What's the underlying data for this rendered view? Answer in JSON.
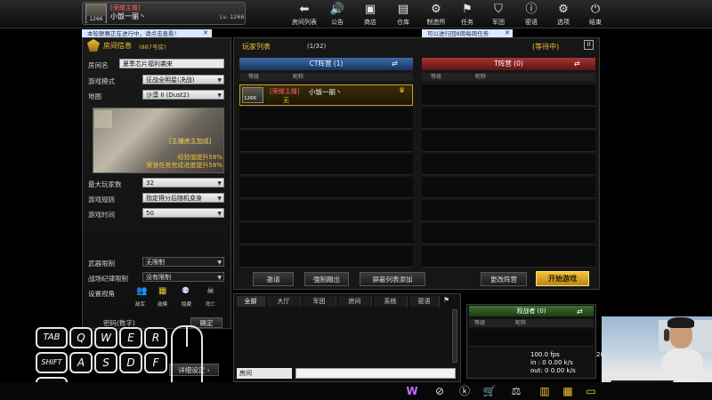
{
  "topbar": {
    "rank_title": "[荣耀主播]",
    "player_name": "小饭一丽丶",
    "level": "Lv. 1266",
    "rank_points": "1266",
    "nav": [
      {
        "label": "房间列表",
        "icon": "back-arrow-icon"
      },
      {
        "label": "公告",
        "icon": "speaker-icon"
      },
      {
        "label": "商店",
        "icon": "shop-icon"
      },
      {
        "label": "仓库",
        "icon": "inventory-icon"
      },
      {
        "label": "制造所",
        "icon": "craft-icon"
      },
      {
        "label": "任务",
        "icon": "mission-icon"
      },
      {
        "label": "军团",
        "icon": "clan-icon"
      },
      {
        "label": "密语",
        "icon": "alert-icon"
      },
      {
        "label": "选项",
        "icon": "gear-icon"
      },
      {
        "label": "结束",
        "icon": "power-icon"
      }
    ]
  },
  "notices": {
    "left": "本轮联赛正在进行中，请点击查看！",
    "right": "可以进行回8周每周任务"
  },
  "room": {
    "title": "房间信息",
    "room_no": "(887号房)",
    "name_label": "房间名",
    "name_value": "夏季芯片福利袭来",
    "mode_label": "游戏模式",
    "mode_value": "征战全明星(决战)",
    "map_label": "地图",
    "map_value": "沙漠 II (Dust2)",
    "map_banner": "[主播房主加成]",
    "map_bonus_1": "经验值提升58%",
    "map_bonus_2": "荣誉任务完成进度提升58%",
    "max_players_label": "最大玩家数",
    "max_players_value": "32",
    "rule_label": "游戏规则",
    "rule_value": "指定得分后随机变身",
    "time_label": "游戏时间",
    "time_value": "50",
    "weapon_label": "武器限制",
    "weapon_value": "无限制",
    "discipline_label": "战场纪律限制",
    "discipline_value": "没有限制",
    "view_label": "设置视角",
    "view_options": [
      "敌军",
      "敌模",
      "隐藏",
      "死亡"
    ],
    "password_label": "密码(数字)",
    "detail_button": "详细设定",
    "help_button": "帮助"
  },
  "players": {
    "title": "玩家列表",
    "count": "(1/32)",
    "status": "(等待中)",
    "ct_team": "CT阵营 (1)",
    "t_team": "T阵营 (0)",
    "col_rank": "等级",
    "col_name": "昵称",
    "slot_player_tag": "[荣耀主播]",
    "slot_player_name": "小饭一丽丶",
    "slot_player_suffix": "无",
    "slot_player_level": "1266",
    "buttons": {
      "invite": "邀请",
      "kick": "强制踢出",
      "block": "屏蔽列表添加",
      "change_team": "更改阵营",
      "start": "开始游戏"
    }
  },
  "chat": {
    "tabs": [
      "全部",
      "大厅",
      "军团",
      "房间",
      "系统",
      "密语"
    ],
    "input_label": "房间"
  },
  "spectator": {
    "title": "观战者 (0)",
    "col_rank": "等级",
    "col_name": "昵称"
  },
  "stats": {
    "fps": "100.0 fps",
    "in": "in : 0 0.00 k/s",
    "out": "out: 0 0.00 k/s",
    "side_num": "20"
  },
  "keys": {
    "tab": "TAB",
    "q": "Q",
    "w": "W",
    "e": "E",
    "r": "R",
    "shift": "SHIFT",
    "a": "A",
    "s": "S",
    "d": "D",
    "f": "F",
    "ctrl": "CTRL"
  }
}
